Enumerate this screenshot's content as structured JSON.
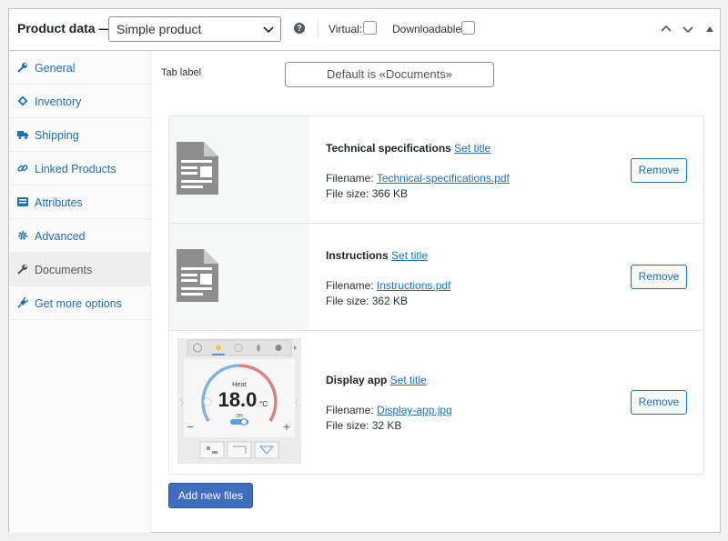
{
  "header": {
    "title": "Product data —",
    "product_type": "Simple product",
    "help": "?",
    "virtual_label": "Virtual:",
    "downloadable_label": "Downloadable:"
  },
  "sidebar": {
    "items": [
      {
        "label": "General",
        "icon": "wrench-icon"
      },
      {
        "label": "Inventory",
        "icon": "tag-icon"
      },
      {
        "label": "Shipping",
        "icon": "truck-icon"
      },
      {
        "label": "Linked Products",
        "icon": "link-icon"
      },
      {
        "label": "Attributes",
        "icon": "list-icon"
      },
      {
        "label": "Advanced",
        "icon": "gear-icon"
      },
      {
        "label": "Documents",
        "icon": "wrench-icon",
        "active": true
      },
      {
        "label": "Get more options",
        "icon": "plug-icon"
      }
    ]
  },
  "documents": {
    "tab_label": "Tab label",
    "tab_placeholder": "Default is «Documents»",
    "set_title_label": "Set title",
    "filename_label": "Filename:",
    "filesize_label": "File size:",
    "remove_label": "Remove",
    "add_button": "Add new files",
    "files": [
      {
        "title": "Technical specifications",
        "filename": "Technical-specifications.pdf",
        "size": "366 KB",
        "thumb": "document-icon"
      },
      {
        "title": "Instructions",
        "filename": "Instructions.pdf",
        "size": "362 KB",
        "thumb": "document-icon"
      },
      {
        "title": "Display app",
        "filename": "Display-app.jpg",
        "size": "32 KB",
        "thumb": "thermostat-image",
        "thumb_text": {
          "mode": "Heat",
          "temp": "18.0",
          "unit": "°C",
          "state": "ON",
          "minus": "−",
          "plus": "+"
        }
      }
    ]
  },
  "colors": {
    "link": "#2271b1",
    "primary": "#3e6ebd",
    "text": "#1d2327"
  }
}
